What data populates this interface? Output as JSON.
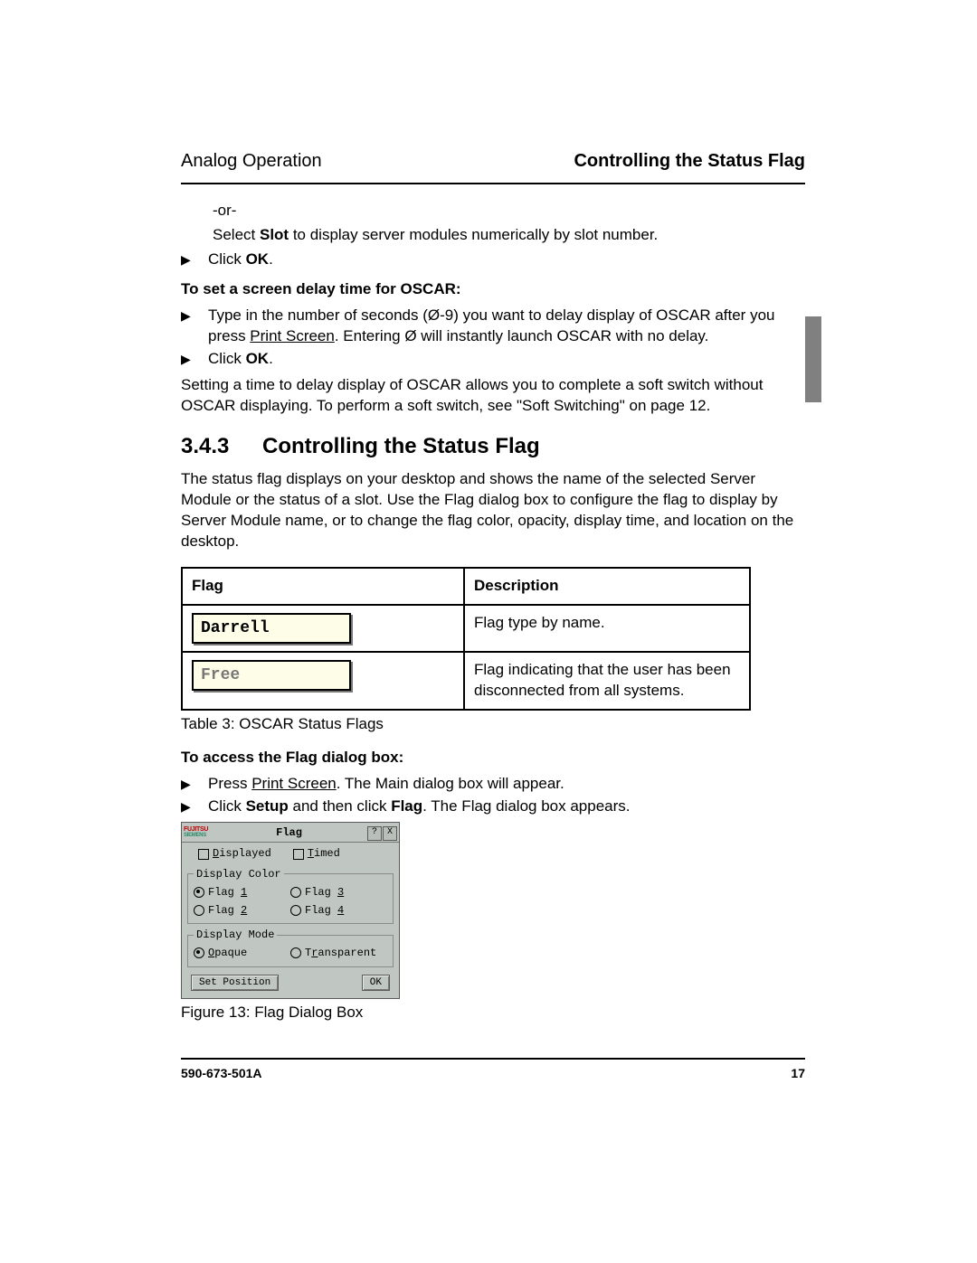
{
  "header": {
    "left": "Analog Operation",
    "right": "Controlling the Status Flag"
  },
  "intro": {
    "or": "-or-",
    "select_slot_pre": "Select ",
    "select_slot_bold": "Slot",
    "select_slot_post": " to display server modules numerically by slot number.",
    "click_ok_pre": "Click ",
    "click_ok_bold": "OK",
    "click_ok_post": "."
  },
  "set_delay": {
    "heading": "To set a screen delay time for OSCAR:",
    "step_type": "Type in the number of seconds (Ø-9) you want to delay display of OSCAR after you press ",
    "print_screen": "Print Screen",
    "step_type_post": ". Entering Ø will instantly launch OSCAR with no delay.",
    "click_ok_pre": "Click ",
    "click_ok_bold": "OK",
    "click_ok_post": ".",
    "note": "Setting a time to delay display of OSCAR allows you to complete a soft switch without OSCAR displaying. To perform a soft switch, see \"Soft Switching\" on page 12."
  },
  "section": {
    "number": "3.4.3",
    "title": "Controlling the Status Flag",
    "para": "The status flag displays on your desktop and shows the name of the selected Server Module or the status of a slot. Use the Flag dialog box to configure the flag to display by Server Module name, or to change the flag color, opacity, display time, and location on the desktop."
  },
  "table": {
    "head_flag": "Flag",
    "head_desc": "Description",
    "rows": [
      {
        "flag_label": "Darrell",
        "desc": "Flag type by name."
      },
      {
        "flag_label": "Free",
        "desc": "Flag indicating that the user has been disconnected from all systems."
      }
    ],
    "caption": "Table 3: OSCAR Status Flags"
  },
  "access": {
    "heading": "To access the Flag dialog box:",
    "step1_pre": "Press ",
    "step1_u": "Print Screen",
    "step1_post": ". The Main dialog box will appear.",
    "step2_pre": "Click ",
    "step2_b1": "Setup",
    "step2_mid": " and then click ",
    "step2_b2": "Flag",
    "step2_post": ". The Flag dialog box appears."
  },
  "dialog": {
    "logo_top": "FUJITSU",
    "logo_sub": "SIEMENS",
    "title": "Flag",
    "help": "?",
    "close": "X",
    "displayed": "Displayed",
    "timed": "Timed",
    "grp_color": "Display Color",
    "flag1": "Flag 1",
    "flag2": "Flag 2",
    "flag3": "Flag 3",
    "flag4": "Flag 4",
    "grp_mode": "Display Mode",
    "opaque": "Opaque",
    "transparent": "Transparent",
    "set_position": "Set Position",
    "ok": "OK"
  },
  "fig_caption": "Figure 13: Flag Dialog Box",
  "footer": {
    "doc": "590-673-501A",
    "page": "17"
  }
}
